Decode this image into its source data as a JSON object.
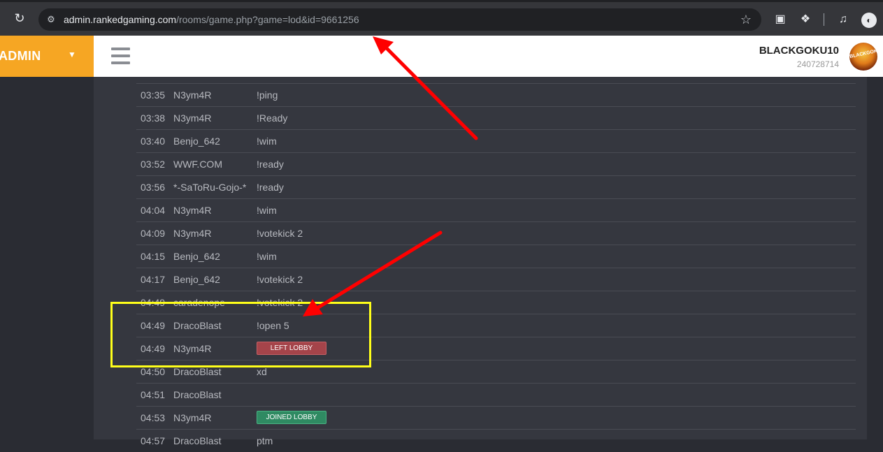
{
  "browser": {
    "url_host": "admin.rankedgaming.com",
    "url_path": "/rooms/game.php?game=lod&id=9661256",
    "icons": [
      "reload-icon",
      "site-info-icon",
      "bookmark-star-icon",
      "extension-icon",
      "puzzle-icon",
      "media-icon",
      "profile-icon"
    ]
  },
  "app": {
    "brand_label": "ADMIN",
    "user": {
      "name": "BLACKGOKU10",
      "id": "240728714"
    },
    "avatar_text": "BLACKGOKU"
  },
  "log": [
    {
      "time": "03:35",
      "name": "N3ym4R",
      "message": "!ping"
    },
    {
      "time": "03:38",
      "name": "N3ym4R",
      "message": "!Ready"
    },
    {
      "time": "03:40",
      "name": "Benjo_642",
      "message": "!wim"
    },
    {
      "time": "03:52",
      "name": "WWF.COM",
      "message": "!ready"
    },
    {
      "time": "03:56",
      "name": "*-SaToRu-Gojo-*",
      "message": "!ready"
    },
    {
      "time": "04:04",
      "name": "N3ym4R",
      "message": "!wim"
    },
    {
      "time": "04:09",
      "name": "N3ym4R",
      "message": "!votekick 2"
    },
    {
      "time": "04:15",
      "name": "Benjo_642",
      "message": "!wim"
    },
    {
      "time": "04:17",
      "name": "Benjo_642",
      "message": "!votekick 2"
    },
    {
      "time": "04:49",
      "name": "caradenope",
      "message": "!votekick 2"
    },
    {
      "time": "04:49",
      "name": "DracoBlast",
      "message": "!open 5"
    },
    {
      "time": "04:49",
      "name": "N3ym4R",
      "badge": "LEFT LOBBY"
    },
    {
      "time": "04:50",
      "name": "DracoBlast",
      "message": "xd"
    },
    {
      "time": "04:51",
      "name": "DracoBlast",
      "message": ""
    },
    {
      "time": "04:53",
      "name": "N3ym4R",
      "badge": "JOINED LOBBY"
    },
    {
      "time": "04:57",
      "name": "DracoBlast",
      "message": "ptm"
    }
  ],
  "colors": {
    "brand": "#f6a623",
    "left_badge": "#a5444a",
    "joined_badge": "#2f8a62",
    "annotation_box": "#ffff1a",
    "annotation_arrow": "#ff0000"
  }
}
